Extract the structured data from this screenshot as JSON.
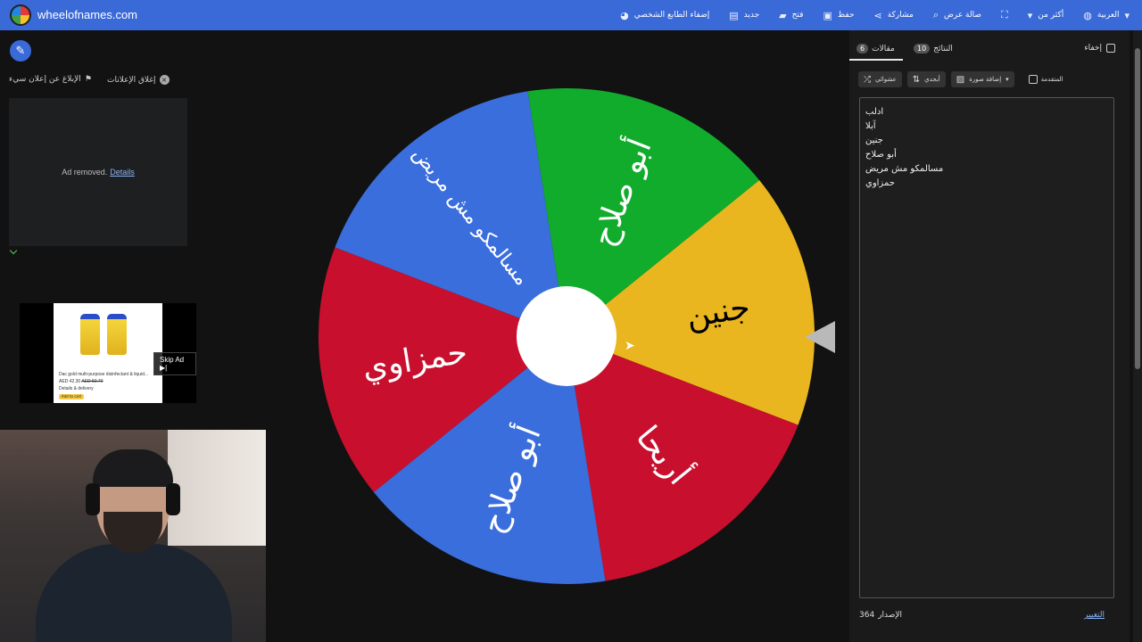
{
  "site": {
    "title": "wheelofnames.com"
  },
  "nav": {
    "items": [
      {
        "label": "العربية",
        "icon": "globe-icon"
      },
      {
        "label": "أكثر من",
        "icon": "chevron-down-icon"
      },
      {
        "label": "",
        "icon": "fullscreen-icon"
      },
      {
        "label": "صالة عرض",
        "icon": "search-icon"
      },
      {
        "label": "مشاركة",
        "icon": "share-icon"
      },
      {
        "label": "حفظ",
        "icon": "save-icon"
      },
      {
        "label": "فتح",
        "icon": "folder-icon"
      },
      {
        "label": "جديد",
        "icon": "file-icon"
      },
      {
        "label": "إضفاء الطابع الشخصي",
        "icon": "palette-icon"
      }
    ]
  },
  "ads": {
    "report_label": "الإبلاغ عن إعلان سيء",
    "close_label": "إغلاق الإعلانات",
    "removed_text": "Ad removed.",
    "details_link": "Details",
    "skip_label": "Skip Ad ▶|",
    "product_title": "Dac gold multi-purpose disinfectant & liquid...",
    "product_price": "AED 42.30",
    "product_old_price": "AED 50.70",
    "product_details": "Details & delivery",
    "product_button": "Add to cart"
  },
  "wheel": {
    "slices": [
      {
        "label": "جنين",
        "color": "#e9b620"
      },
      {
        "label": "أريحا",
        "color": "#c8102e"
      },
      {
        "label": "أبو صلاح",
        "color": "#3a6edc"
      },
      {
        "label": "حمزاوي",
        "color": "#c8102e"
      },
      {
        "label": "مسالمكو مش مريض",
        "color": "#3a6edc"
      },
      {
        "label": "أبو صلاح",
        "color": "#11ac2c"
      }
    ]
  },
  "panel": {
    "tab_entries_label": "مقالات",
    "tab_entries_count": "6",
    "tab_results_label": "النتائج",
    "tab_results_count": "10",
    "hide_label": "إخفاء",
    "shuffle_label": "عشوائي",
    "sort_label": "أبجدي",
    "add_image_label": "إضافة صورة",
    "advanced_label": "المتقدمة",
    "entries": [
      "ادلب",
      "آبلا",
      "جنين",
      "أبو صلاح",
      "مسالمكو مش مريض",
      "حمزاوي"
    ],
    "version_label": "الإصدار",
    "version_number": "364",
    "changelog_label": "التغيير"
  }
}
